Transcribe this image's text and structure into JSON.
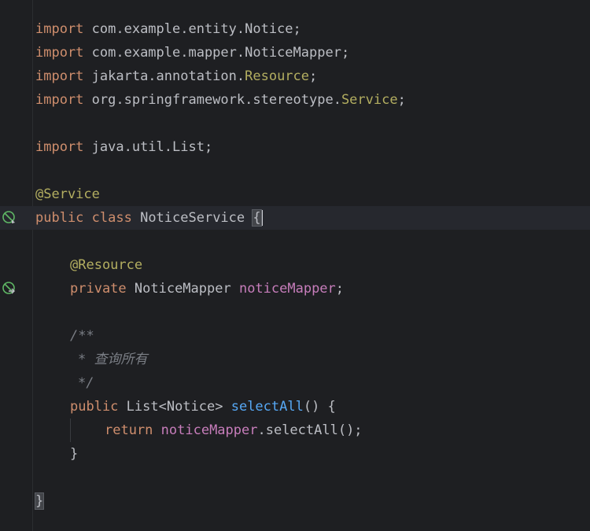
{
  "colors": {
    "background": "#1e1f22",
    "keyword": "#cf8e6d",
    "annotation": "#b3ae60",
    "field": "#c77dbb",
    "method": "#56a8f5",
    "comment": "#7a7e85",
    "text": "#bcbec4"
  },
  "code": {
    "l1": {
      "kw": "import",
      "pre": " com.example.entity.Notice;"
    },
    "l2": {
      "kw": "import",
      "pre": " com.example.mapper.NoticeMapper;"
    },
    "l3": {
      "kw": "import",
      "pre": " jakarta.annotation.",
      "ref": "Resource",
      "post": ";"
    },
    "l4": {
      "kw": "import",
      "pre": " org.springframework.stereotype.",
      "ref": "Service",
      "post": ";"
    },
    "l6": {
      "kw": "import",
      "pre": " java.util.List;"
    },
    "l8": {
      "ann": "@Service"
    },
    "l9": {
      "kw1": "public",
      "kw2": " class",
      "name": " NoticeService ",
      "brace": "{"
    },
    "l11": {
      "ann": "@Resource"
    },
    "l12": {
      "kw": "private",
      "type": " NoticeMapper ",
      "field": "noticeMapper",
      "post": ";"
    },
    "l14": {
      "cmt": "/**"
    },
    "l15": {
      "cmt": "* 查询所有"
    },
    "l16": {
      "cmt": "*/"
    },
    "l17": {
      "kw": "public",
      "type": " List<Notice> ",
      "fn": "selectAll",
      "post": "() {"
    },
    "l18": {
      "kw": "return",
      "field": " noticeMapper",
      "post": ".selectAll();"
    },
    "l19": {
      "text": "}"
    },
    "l21": {
      "brace": "}"
    }
  },
  "gutter_icons": {
    "class_icon": "spring-bean-icon",
    "field_icon": "spring-injection-icon"
  }
}
